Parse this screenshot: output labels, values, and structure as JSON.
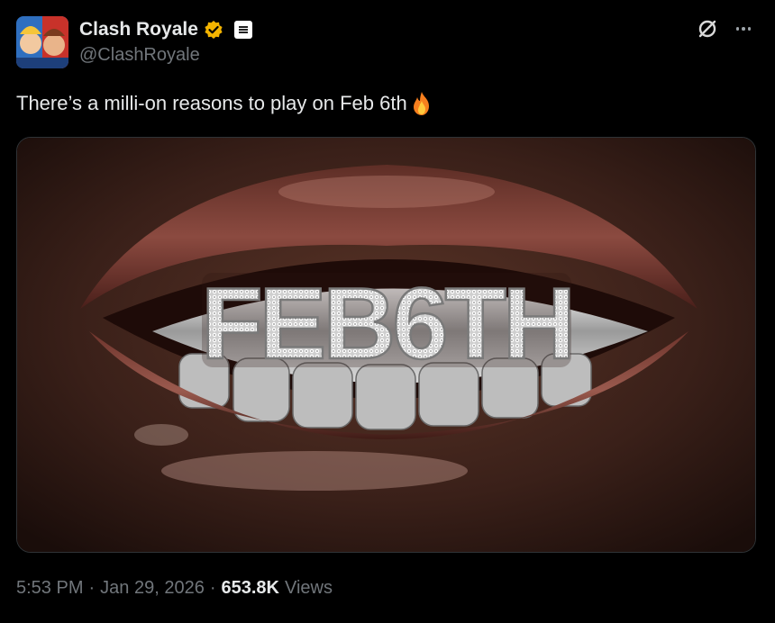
{
  "account": {
    "display_name": "Clash Royale",
    "handle": "@ClashRoyale",
    "verified_badge_color": "#f4b400",
    "icons": [
      "verified-badge-icon",
      "affiliate-badge-icon",
      "grok-icon",
      "more-icon"
    ]
  },
  "tweet": {
    "text": "There’s a milli-on reasons to play on Feb 6th",
    "emoji": "fire-emoji-icon",
    "media": {
      "alt_visible_text": "FEB6TH"
    }
  },
  "metadata": {
    "time": "5:53 PM",
    "separator": "·",
    "date": "Jan 29, 2026",
    "views_count": "653.8K",
    "views_label": "Views"
  }
}
